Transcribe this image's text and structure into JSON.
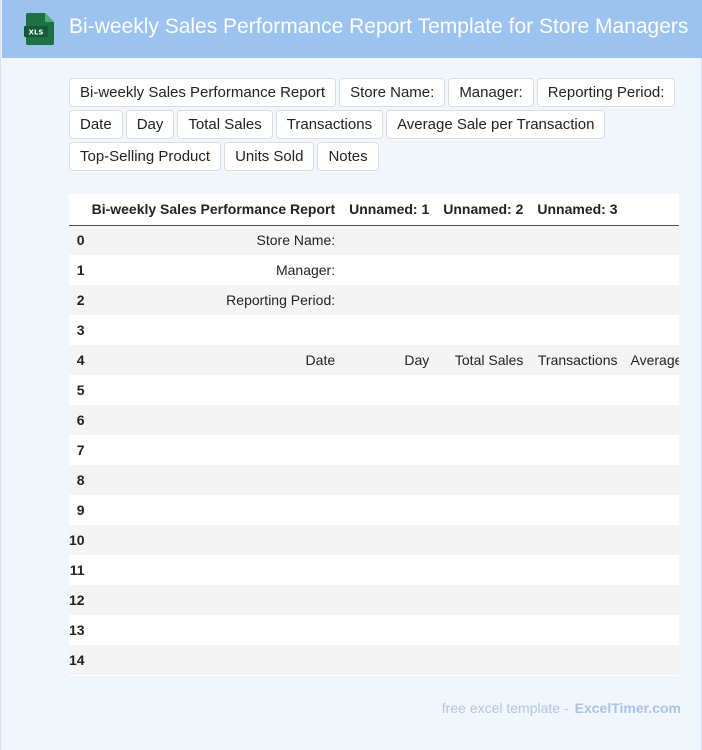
{
  "header": {
    "title": "Bi-weekly Sales Performance Report Template for Store Managers",
    "icon_label": "XLS"
  },
  "chips": [
    "Bi-weekly Sales Performance Report",
    "Store Name:",
    "Manager:",
    "Reporting Period:",
    "Date",
    "Day",
    "Total Sales",
    "Transactions",
    "Average Sale per Transaction",
    "Top-Selling Product",
    "Units Sold",
    "Notes"
  ],
  "table": {
    "columns": [
      "Bi-weekly Sales Performance Report",
      "Unnamed: 1",
      "Unnamed: 2",
      "Unnamed: 3",
      ""
    ],
    "rows": [
      {
        "idx": "0",
        "cells": [
          "Store Name:",
          "",
          "",
          "",
          ""
        ]
      },
      {
        "idx": "1",
        "cells": [
          "Manager:",
          "",
          "",
          "",
          ""
        ]
      },
      {
        "idx": "2",
        "cells": [
          "Reporting Period:",
          "",
          "",
          "",
          ""
        ]
      },
      {
        "idx": "3",
        "cells": [
          "",
          "",
          "",
          "",
          ""
        ]
      },
      {
        "idx": "4",
        "cells": [
          "Date",
          "Day",
          "Total Sales",
          "Transactions",
          "Average"
        ]
      },
      {
        "idx": "5",
        "cells": [
          "",
          "",
          "",
          "",
          ""
        ]
      },
      {
        "idx": "6",
        "cells": [
          "",
          "",
          "",
          "",
          ""
        ]
      },
      {
        "idx": "7",
        "cells": [
          "",
          "",
          "",
          "",
          ""
        ]
      },
      {
        "idx": "8",
        "cells": [
          "",
          "",
          "",
          "",
          ""
        ]
      },
      {
        "idx": "9",
        "cells": [
          "",
          "",
          "",
          "",
          ""
        ]
      },
      {
        "idx": "10",
        "cells": [
          "",
          "",
          "",
          "",
          ""
        ]
      },
      {
        "idx": "11",
        "cells": [
          "",
          "",
          "",
          "",
          ""
        ]
      },
      {
        "idx": "12",
        "cells": [
          "",
          "",
          "",
          "",
          ""
        ]
      },
      {
        "idx": "13",
        "cells": [
          "",
          "",
          "",
          "",
          ""
        ]
      },
      {
        "idx": "14",
        "cells": [
          "",
          "",
          "",
          "",
          ""
        ]
      }
    ]
  },
  "footer": {
    "text": "free excel template -",
    "brand": "ExcelTimer.com"
  },
  "colors": {
    "header_bg": "#9cc3ef",
    "page_bg": "#f1f6fd",
    "icon_green": "#1e7145"
  }
}
